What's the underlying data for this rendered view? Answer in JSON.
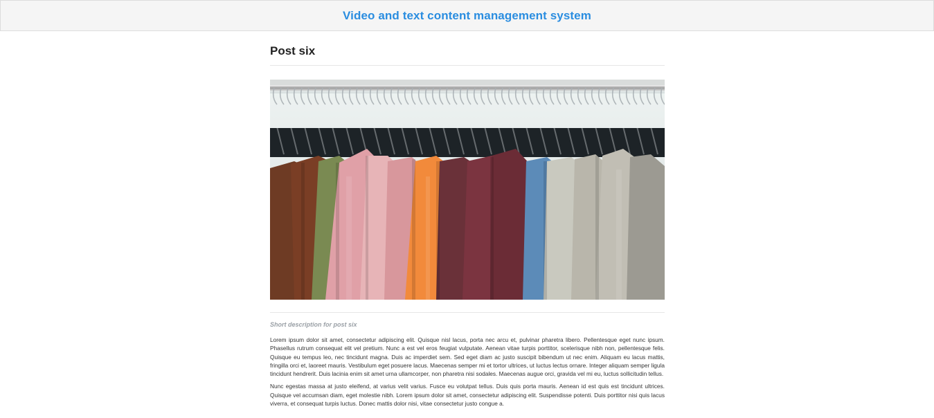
{
  "header": {
    "site_title": "Video and text content management system"
  },
  "post": {
    "title": "Post six",
    "image_alt": "Clothes hanging on a rack",
    "short_description": "Short description for post six",
    "paragraphs": [
      "Lorem ipsum dolor sit amet, consectetur adipiscing elit. Quisque nisl lacus, porta nec arcu et, pulvinar pharetra libero. Pellentesque eget nunc ipsum. Phasellus rutrum consequat elit vel pretium. Nunc a est vel eros feugiat vulputate. Aenean vitae turpis porttitor, scelerisque nibh non, pellentesque felis. Quisque eu tempus leo, nec tincidunt magna. Duis ac imperdiet sem. Sed eget diam ac justo suscipit bibendum ut nec enim. Aliquam eu lacus mattis, fringilla orci et, laoreet mauris. Vestibulum eget posuere lacus. Maecenas semper mi et tortor ultrices, ut luctus lectus ornare. Integer aliquam semper ligula tincidunt hendrerit. Duis lacinia enim sit amet urna ullamcorper, non pharetra nisi sodales. Maecenas augue orci, gravida vel mi eu, luctus sollicitudin tellus.",
      "Nunc egestas massa at justo eleifend, at varius velit varius. Fusce eu volutpat tellus. Duis quis porta mauris. Aenean id est quis est tincidunt ultrices. Quisque vel accumsan diam, eget molestie nibh. Lorem ipsum dolor sit amet, consectetur adipiscing elit. Suspendisse potenti. Duis porttitor nisi quis lacus viverra, et consequat turpis luctus. Donec mattis dolor nisi, vitae consectetur justo congue a."
    ]
  },
  "colors": {
    "accent": "#2a8de0",
    "header_bg": "#f5f5f5",
    "muted_text": "#9aa0a6"
  }
}
